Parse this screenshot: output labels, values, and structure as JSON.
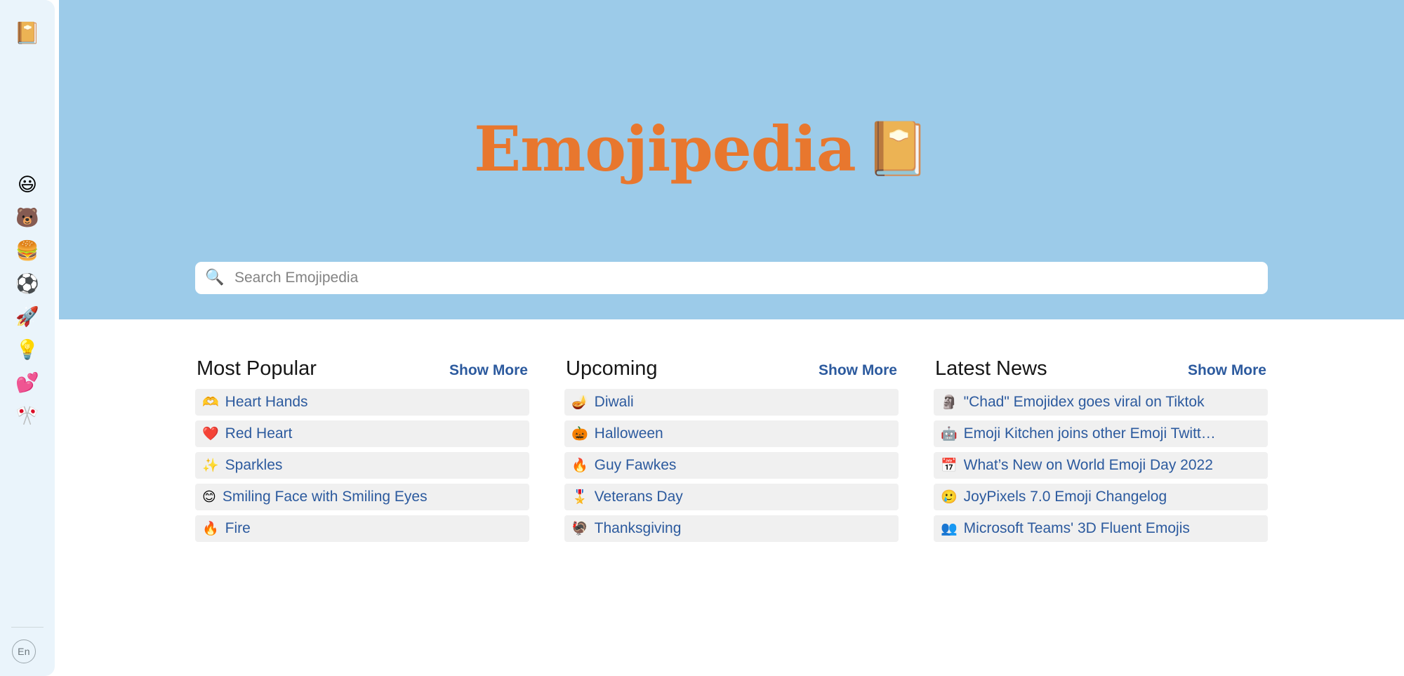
{
  "sidebar": {
    "logo": {
      "name": "emojipedia-book-logo",
      "glyph": "📔"
    },
    "items": [
      {
        "name": "sidebar-item-smileys",
        "glyph": "😃",
        "label": "Smileys & Emotion"
      },
      {
        "name": "sidebar-item-animals",
        "glyph": "🐻",
        "label": "Animals & Nature"
      },
      {
        "name": "sidebar-item-food",
        "glyph": "🍔",
        "label": "Food & Drink"
      },
      {
        "name": "sidebar-item-activity",
        "glyph": "⚽",
        "label": "Activity"
      },
      {
        "name": "sidebar-item-travel",
        "glyph": "🚀",
        "label": "Travel & Places"
      },
      {
        "name": "sidebar-item-objects",
        "glyph": "💡",
        "label": "Objects"
      },
      {
        "name": "sidebar-item-symbols",
        "glyph": "💕",
        "label": "Symbols"
      },
      {
        "name": "sidebar-item-flags",
        "glyph": "🎌",
        "label": "Flags"
      }
    ],
    "language_button": "En"
  },
  "hero": {
    "brand_text": "Emojipedia",
    "brand_emoji": "📔",
    "background_color": "#9CCBE9",
    "brand_color": "#E8772E"
  },
  "search": {
    "icon": "🔍",
    "value": "",
    "placeholder": "Search Emojipedia"
  },
  "columns": [
    {
      "id": "most-popular",
      "title": "Most Popular",
      "show_more": "Show More",
      "items": [
        {
          "emoji": "🫶",
          "label": "Heart Hands"
        },
        {
          "emoji": "❤️",
          "label": "Red Heart"
        },
        {
          "emoji": "✨",
          "label": "Sparkles"
        },
        {
          "emoji": "😊",
          "label": "Smiling Face with Smiling Eyes"
        },
        {
          "emoji": "🔥",
          "label": "Fire"
        }
      ]
    },
    {
      "id": "upcoming",
      "title": "Upcoming",
      "show_more": "Show More",
      "items": [
        {
          "emoji": "🪔",
          "label": "Diwali"
        },
        {
          "emoji": "🎃",
          "label": "Halloween"
        },
        {
          "emoji": "🔥",
          "label": "Guy Fawkes"
        },
        {
          "emoji": "🎖️",
          "label": "Veterans Day"
        },
        {
          "emoji": "🦃",
          "label": "Thanksgiving"
        }
      ]
    },
    {
      "id": "latest-news",
      "title": "Latest News",
      "show_more": "Show More",
      "items": [
        {
          "emoji": "🗿",
          "label": "\"Chad\" Emojidex goes viral on Tiktok"
        },
        {
          "emoji": "🤖",
          "label": "Emoji Kitchen joins other Emoji Twitt…"
        },
        {
          "emoji": "📅",
          "label": "What’s New on World Emoji Day 2022"
        },
        {
          "emoji": "🥲",
          "label": "JoyPixels 7.0 Emoji Changelog"
        },
        {
          "emoji": "👥",
          "label": "Microsoft Teams' 3D Fluent Emojis"
        }
      ]
    }
  ],
  "colors": {
    "hero_blue": "#9CCBE9",
    "sidebar_blue": "#EAF4FB",
    "brand_orange": "#E8772E",
    "link_blue": "#2C5A9E",
    "row_gray": "#F0F0F0"
  }
}
